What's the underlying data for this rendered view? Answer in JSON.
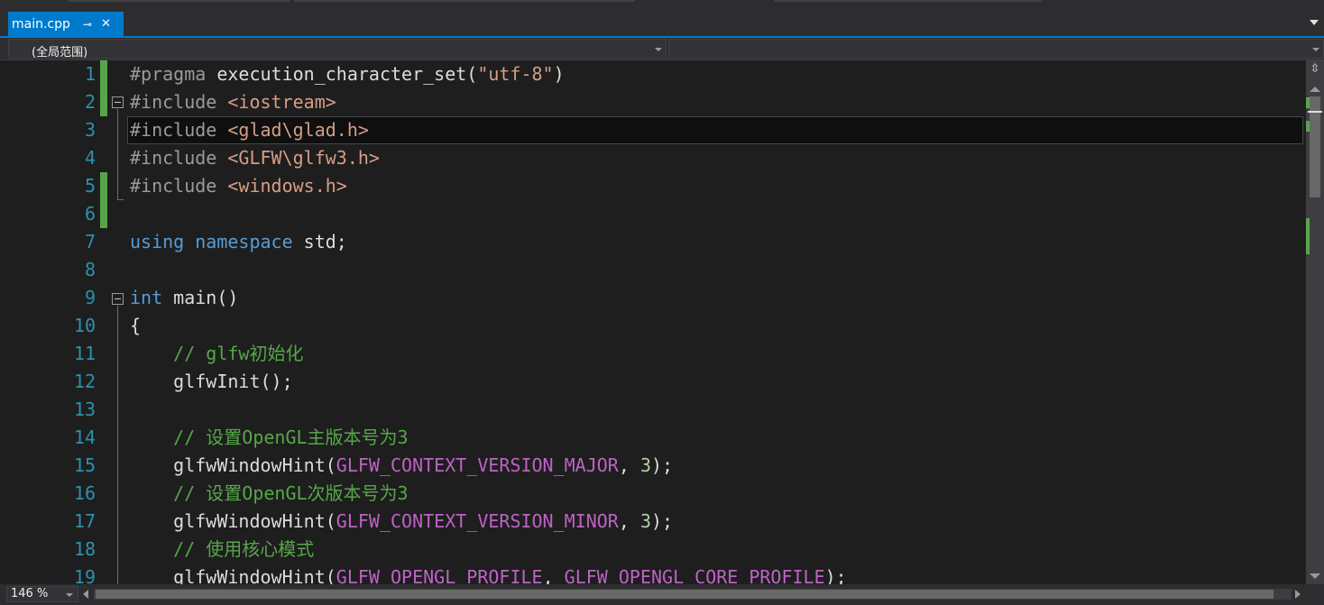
{
  "tab": {
    "title": "main.cpp",
    "pin_icon": "pin-icon",
    "close_glyph": "✕"
  },
  "navbar": {
    "scope": "(全局范围)",
    "member": ""
  },
  "editor": {
    "current_line": 3,
    "lines": [
      {
        "num": "1",
        "tokens": [
          {
            "t": "#pragma ",
            "c": "pp"
          },
          {
            "t": "execution_character_set(",
            "c": "pl"
          },
          {
            "t": "\"utf-8\"",
            "c": "str"
          },
          {
            "t": ")",
            "c": "pl"
          }
        ]
      },
      {
        "num": "2",
        "tokens": [
          {
            "t": "#include ",
            "c": "pp"
          },
          {
            "t": "<iostream>",
            "c": "str"
          }
        ]
      },
      {
        "num": "3",
        "tokens": [
          {
            "t": "#include ",
            "c": "pp"
          },
          {
            "t": "<glad\\glad.h>",
            "c": "str"
          }
        ]
      },
      {
        "num": "4",
        "tokens": [
          {
            "t": "#include ",
            "c": "pp"
          },
          {
            "t": "<GLFW\\glfw3.h>",
            "c": "str"
          }
        ]
      },
      {
        "num": "5",
        "tokens": [
          {
            "t": "#include ",
            "c": "pp"
          },
          {
            "t": "<windows.h>",
            "c": "str"
          }
        ]
      },
      {
        "num": "6",
        "tokens": []
      },
      {
        "num": "7",
        "tokens": [
          {
            "t": "using ",
            "c": "kw"
          },
          {
            "t": "namespace ",
            "c": "kw"
          },
          {
            "t": "std;",
            "c": "pl"
          }
        ]
      },
      {
        "num": "8",
        "tokens": []
      },
      {
        "num": "9",
        "tokens": [
          {
            "t": "int ",
            "c": "kw"
          },
          {
            "t": "main()",
            "c": "pl"
          }
        ]
      },
      {
        "num": "10",
        "tokens": [
          {
            "t": "{",
            "c": "pl"
          }
        ]
      },
      {
        "num": "11",
        "tokens": [
          {
            "t": "    ",
            "c": "pl"
          },
          {
            "t": "// glfw初始化",
            "c": "cm"
          }
        ]
      },
      {
        "num": "12",
        "tokens": [
          {
            "t": "    glfwInit();",
            "c": "pl"
          }
        ]
      },
      {
        "num": "13",
        "tokens": []
      },
      {
        "num": "14",
        "tokens": [
          {
            "t": "    ",
            "c": "pl"
          },
          {
            "t": "// 设置OpenGL主版本号为3",
            "c": "cm"
          }
        ]
      },
      {
        "num": "15",
        "tokens": [
          {
            "t": "    glfwWindowHint(",
            "c": "pl"
          },
          {
            "t": "GLFW_CONTEXT_VERSION_MAJOR",
            "c": "mac"
          },
          {
            "t": ", ",
            "c": "pl"
          },
          {
            "t": "3",
            "c": "num"
          },
          {
            "t": ");",
            "c": "pl"
          }
        ]
      },
      {
        "num": "16",
        "tokens": [
          {
            "t": "    ",
            "c": "pl"
          },
          {
            "t": "// 设置OpenGL次版本号为3",
            "c": "cm"
          }
        ]
      },
      {
        "num": "17",
        "tokens": [
          {
            "t": "    glfwWindowHint(",
            "c": "pl"
          },
          {
            "t": "GLFW_CONTEXT_VERSION_MINOR",
            "c": "mac"
          },
          {
            "t": ", ",
            "c": "pl"
          },
          {
            "t": "3",
            "c": "num"
          },
          {
            "t": ");",
            "c": "pl"
          }
        ]
      },
      {
        "num": "18",
        "tokens": [
          {
            "t": "    ",
            "c": "pl"
          },
          {
            "t": "// 使用核心模式",
            "c": "cm"
          }
        ]
      },
      {
        "num": "19",
        "tokens": [
          {
            "t": "    glfwWindowHint(",
            "c": "pl"
          },
          {
            "t": "GLFW_OPENGL_PROFILE",
            "c": "mac"
          },
          {
            "t": ", ",
            "c": "pl"
          },
          {
            "t": "GLFW_OPENGL_CORE_PROFILE",
            "c": "mac"
          },
          {
            "t": ");",
            "c": "pl"
          }
        ]
      }
    ]
  },
  "scrollbar": {
    "split_glyph": "⇳"
  },
  "statusbar": {
    "zoom": "146 %"
  },
  "colors": {
    "accent": "#007acc",
    "change_marker": "#57a64a",
    "line_number": "#2b91af"
  }
}
